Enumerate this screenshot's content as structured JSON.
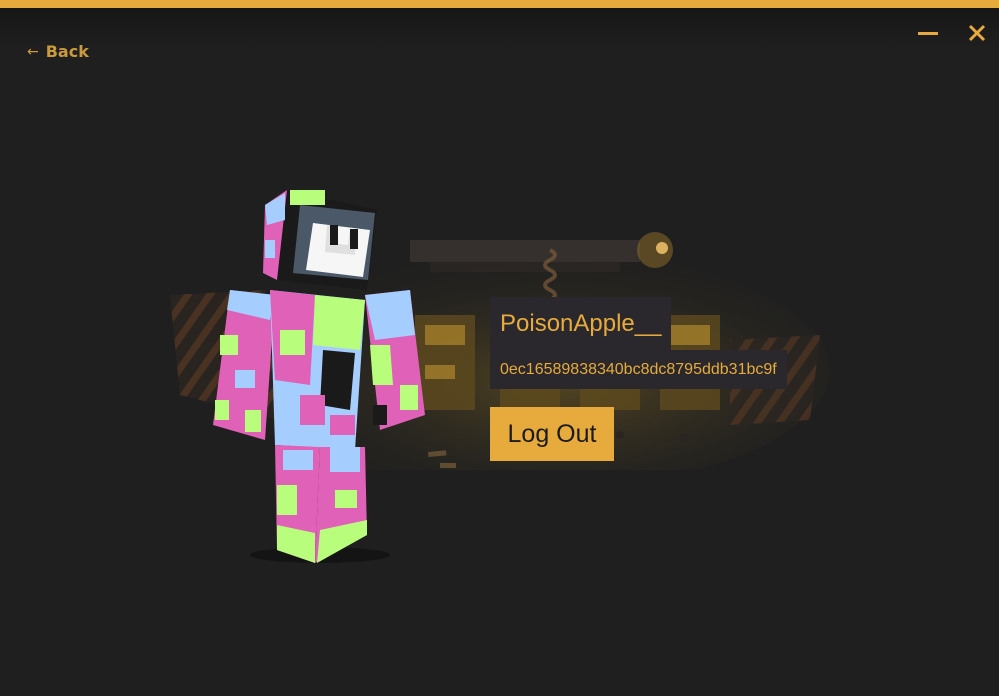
{
  "window": {
    "accent_color": "#e6ab3c",
    "background_color": "#1f1f1f",
    "minimize_icon": "minimize-icon",
    "close_icon": "close-icon"
  },
  "nav": {
    "back_arrow": "←",
    "back_label": "Back"
  },
  "profile": {
    "username": "PoisonApple__",
    "uuid": "0ec16589838340bc8dc8795ddb31bc9f",
    "logout_label": "Log Out",
    "skin_colors": [
      "#e061b8",
      "#b9fd7d",
      "#a5cdfd",
      "#1a1a1a",
      "#ffffff"
    ]
  }
}
